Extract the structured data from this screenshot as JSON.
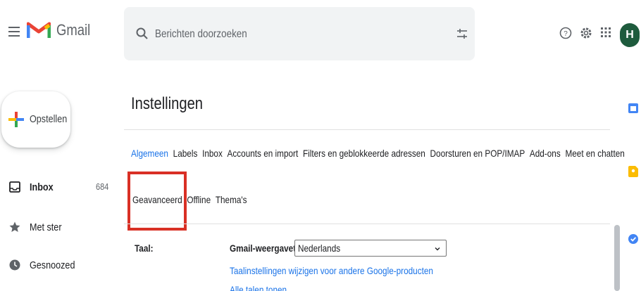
{
  "header": {
    "brand": "Gmail",
    "search_placeholder": "Berichten doorzoeken",
    "avatar_initial": "H"
  },
  "sidebar": {
    "compose_label": "Opstellen",
    "items": [
      {
        "label": "Inbox",
        "count": "684",
        "icon": "inbox-icon"
      },
      {
        "label": "Met ster",
        "count": "",
        "icon": "star-icon"
      },
      {
        "label": "Gesnoozed",
        "count": "",
        "icon": "clock-icon"
      }
    ]
  },
  "main": {
    "title": "Instellingen",
    "tabs_row1": [
      "Algemeen",
      "Labels",
      "Inbox",
      "Accounts en import",
      "Filters en geblokkeerde adressen",
      "Doorsturen en POP/IMAP",
      "Add-ons",
      "Meet en chatten"
    ],
    "tabs_row2": [
      "Geavanceerd",
      "Offline",
      "Thema's"
    ],
    "active_tab": "Algemeen",
    "language": {
      "label": "Taal:",
      "display_label": "Gmail-weergavetaal:",
      "selected": "Nederlands",
      "change_link": "Taalinstellingen wijzigen voor andere Google-producten",
      "more_link": "Alle talen tonen"
    }
  },
  "colors": {
    "accent": "#1a73e8",
    "highlight": "#d93025",
    "avatar_bg": "#1e5b3d"
  }
}
